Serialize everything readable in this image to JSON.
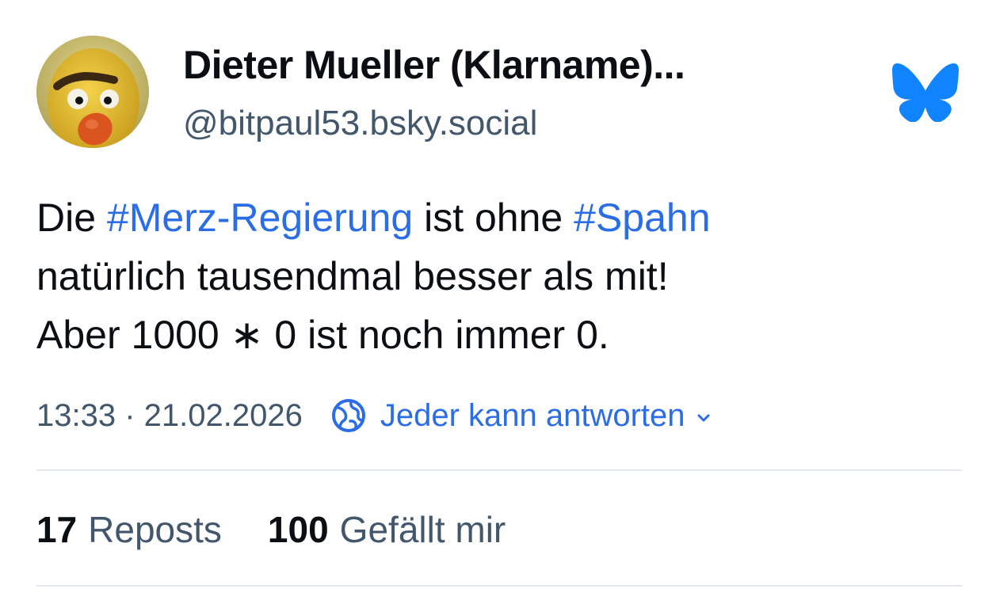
{
  "author": {
    "display_name": "Dieter Mueller (Klarname)...",
    "handle": "@bitpaul53.bsky.social",
    "avatar_icon": "puppet-avatar"
  },
  "brand": {
    "logo_icon": "bluesky-butterfly-icon",
    "accent_color": "#1083fe"
  },
  "post": {
    "line1": {
      "pre": "Die ",
      "tag1": "#Merz-Regierung",
      "mid": " ist ohne ",
      "tag2": "#Spahn"
    },
    "line2": "natürlich tausendmal besser als mit!",
    "line3": "Aber 1000 ∗ 0 ist noch immer 0."
  },
  "meta": {
    "timestamp": "13:33 · 21.02.2026",
    "reply_setting": "Jeder kann antworten",
    "reply_icon": "globe-icon",
    "chevron_icon": "chevron-down-icon"
  },
  "stats": {
    "reposts_count": "17",
    "reposts_label": "Reposts",
    "likes_count": "100",
    "likes_label": "Gefällt mir"
  }
}
